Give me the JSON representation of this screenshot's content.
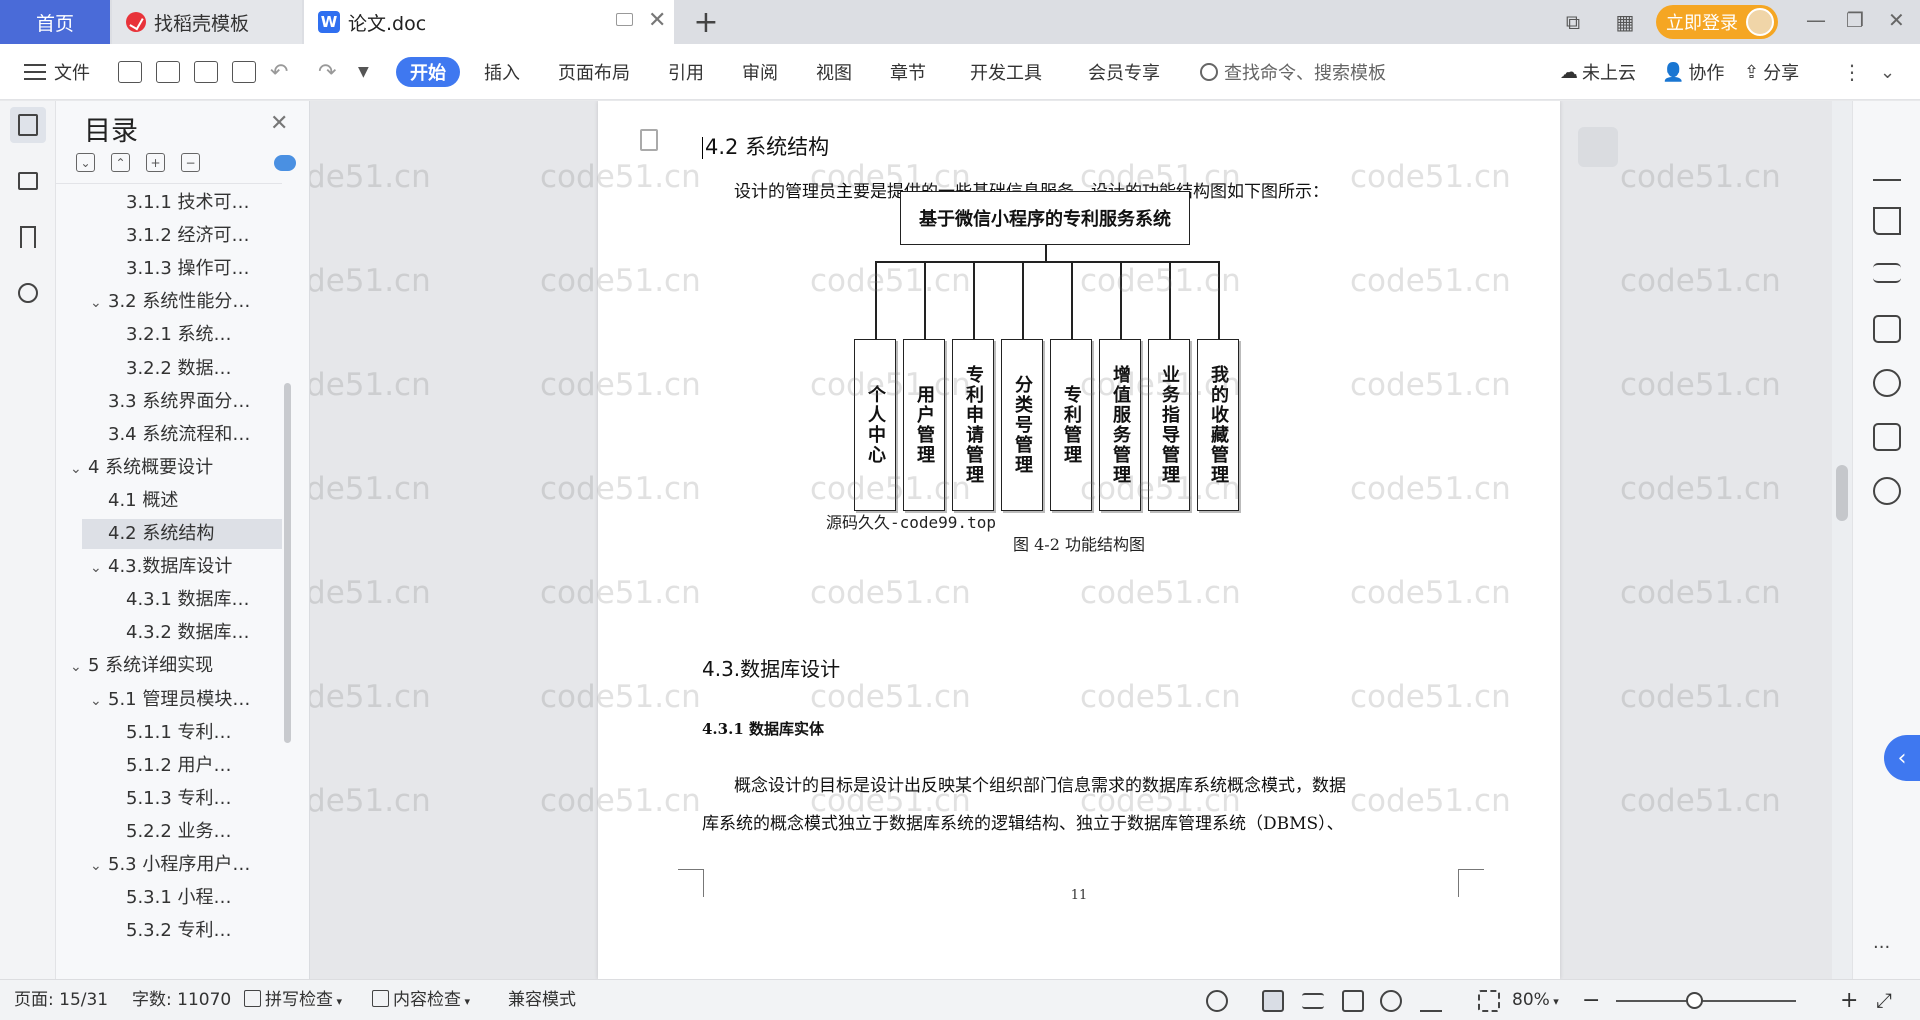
{
  "tabs": {
    "home": "首页",
    "docer": "找稻壳模板",
    "doc": "论文.doc",
    "doc_icon": "W"
  },
  "titlebar": {
    "login": "立即登录"
  },
  "toolbar": {
    "file": "文件",
    "menus": [
      "开始",
      "插入",
      "页面布局",
      "引用",
      "审阅",
      "视图",
      "章节",
      "开发工具",
      "会员专享"
    ],
    "search_placeholder": "查找命令、搜索模板",
    "cloud": "未上云",
    "collab": "协作",
    "share": "分享"
  },
  "toc": {
    "title": "目录",
    "items": [
      {
        "label": "3.1.1 技术可…",
        "level": 3
      },
      {
        "label": "3.1.2 经济可…",
        "level": 3
      },
      {
        "label": "3.1.3 操作可…",
        "level": 3
      },
      {
        "label": "3.2 系统性能分…",
        "level": 2,
        "arrow": "v"
      },
      {
        "label": "3.2.1  系统…",
        "level": 3
      },
      {
        "label": "3.2.2  数据…",
        "level": 3
      },
      {
        "label": "3.3 系统界面分…",
        "level": 2
      },
      {
        "label": "3.4 系统流程和…",
        "level": 2
      },
      {
        "label": "4 系统概要设计",
        "level": 1,
        "arrow": "v"
      },
      {
        "label": "4.1 概述",
        "level": 2
      },
      {
        "label": "4.2 系统结构",
        "level": 2,
        "selected": true
      },
      {
        "label": "4.3.数据库设计",
        "level": 2,
        "arrow": "v"
      },
      {
        "label": "4.3.1 数据库…",
        "level": 3
      },
      {
        "label": "4.3.2 数据库…",
        "level": 3
      },
      {
        "label": "5 系统详细实现",
        "level": 1,
        "arrow": "v"
      },
      {
        "label": "5.1  管理员模块…",
        "level": 2,
        "arrow": "v"
      },
      {
        "label": "5.1.1  专利…",
        "level": 3
      },
      {
        "label": "5.1.2  用户…",
        "level": 3
      },
      {
        "label": "5.1.3  专利…",
        "level": 3
      },
      {
        "label": "5.2.2  业务…",
        "level": 3
      },
      {
        "label": "5.3 小程序用户…",
        "level": 2,
        "arrow": "v"
      },
      {
        "label": "5.3.1  小程…",
        "level": 3
      },
      {
        "label": "5.3.2  专利…",
        "level": 3
      }
    ]
  },
  "document": {
    "heading": "4.2 系统结构",
    "intro": "设计的管理员主要是提供的一些基础信息服务。设计的功能结构图如下图所示：",
    "diagram_root": "基于微信小程序的专利服务系统",
    "diagram_nodes": [
      "个人中心",
      "用户管理",
      "专利申请管理",
      "分类号管理",
      "专利管理",
      "增值服务管理",
      "业务指导管理",
      "我的收藏管理"
    ],
    "source_note": "源码久久-code99.top",
    "caption": "图 4-2 功能结构图",
    "section": "4.3.数据库设计",
    "subsection": "4.3.1 数据库实体",
    "para1": "概念设计的目标是设计出反映某个组织部门信息需求的数据库系统概念模式，数据",
    "para2": "库系统的概念模式独立于数据库系统的逻辑结构、独立于数据库管理系统（DBMS）、",
    "page_number": "11",
    "watermark": "code51.cn"
  },
  "status": {
    "page": "页面: 15/31",
    "words": "字数: 11070",
    "spell": "拼写检查",
    "content": "内容检查",
    "compat": "兼容模式",
    "zoom": "80%",
    "zoom_value": 0.8
  }
}
